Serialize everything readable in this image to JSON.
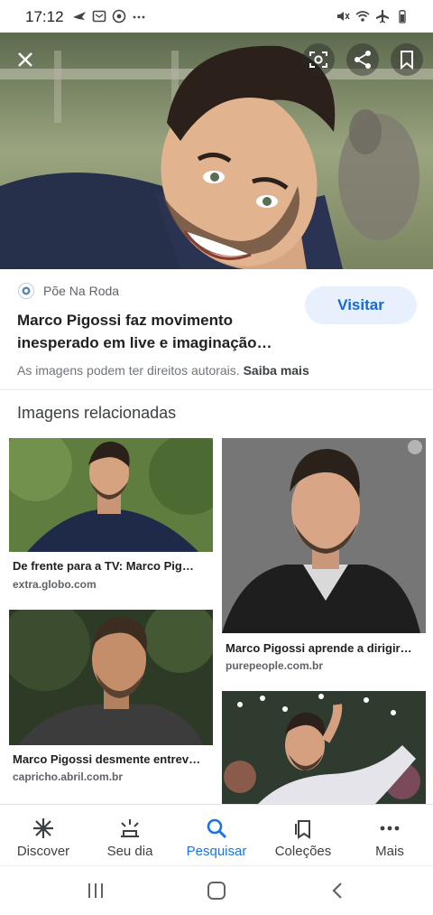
{
  "status_bar": {
    "time": "17:12",
    "left_icons": [
      "flying-bird-icon",
      "mail-icon",
      "chrome-icon",
      "more-dots-icon"
    ],
    "right_icons": [
      "muted-icon",
      "wifi-icon",
      "airplane-icon",
      "battery-icon"
    ]
  },
  "hero": {
    "buttons": [
      "close-icon",
      "lens-icon",
      "share-icon",
      "bookmark-icon"
    ]
  },
  "result": {
    "source_name": "Põe Na Roda",
    "title": "Marco Pigossi faz movimento inesperado em live e imaginação…",
    "visit_label": "Visitar",
    "copyright_text": "As imagens podem ter direitos autorais.",
    "learn_more": "Saiba mais"
  },
  "related": {
    "title": "Imagens relacionadas",
    "items": [
      {
        "caption": "De frente para a TV: Marco Pig…",
        "domain": "extra.globo.com"
      },
      {
        "caption": "Marco Pigossi aprende a dirigir…",
        "domain": "purepeople.com.br"
      },
      {
        "caption": "Marco Pigossi desmente entrev…",
        "domain": "capricho.abril.com.br"
      }
    ]
  },
  "bottom_nav": {
    "items": [
      {
        "label": "Discover",
        "icon": "asterisk-icon"
      },
      {
        "label": "Seu dia",
        "icon": "sunrise-icon"
      },
      {
        "label": "Pesquisar",
        "icon": "search-icon"
      },
      {
        "label": "Coleções",
        "icon": "collections-icon"
      },
      {
        "label": "Mais",
        "icon": "more-dots-icon"
      }
    ],
    "active_color": "#1a73e8"
  },
  "system_nav": {
    "icons": [
      "recent-apps-icon",
      "home-icon",
      "back-icon"
    ]
  }
}
